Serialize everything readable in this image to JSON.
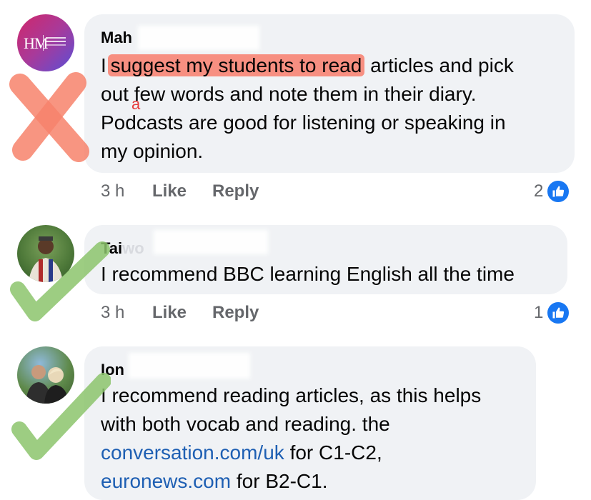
{
  "comments": [
    {
      "avatar_initials": "HM",
      "author": "Mah",
      "text_prefix": "I",
      "highlighted": "suggest my students to read",
      "line1_rest": " articles and pick",
      "line2": "out few words and note them in their diary.",
      "line3": "Podcasts are good for listening or speaking in",
      "line4": "my opinion.",
      "ink_correction": "a",
      "time": "3 h",
      "like_label": "Like",
      "reply_label": "Reply",
      "reaction_count": "2",
      "verdict": "wrong"
    },
    {
      "author": "Tai",
      "author_faded": "wo",
      "line1": "I recommend BBC learning English all the time",
      "time": "3 h",
      "like_label": "Like",
      "reply_label": "Reply",
      "reaction_count": "1",
      "verdict": "right"
    },
    {
      "author": "Ion",
      "line1": "I recommend reading articles, as this helps",
      "line2": "with both vocab and reading. the",
      "link1": "conversation.com/uk",
      "line3_rest": " for C1-C2,",
      "link2": "euronews.com",
      "line4_rest": " for B2-C1.",
      "verdict": "right"
    }
  ],
  "colors": {
    "bubble": "#f0f2f5",
    "highlight": "#fa6e5a",
    "cross": "#f7836c",
    "tick": "#8cc46c",
    "link": "#1e5fb3",
    "meta": "#65676b",
    "reaction_blue": "#1877f2"
  }
}
